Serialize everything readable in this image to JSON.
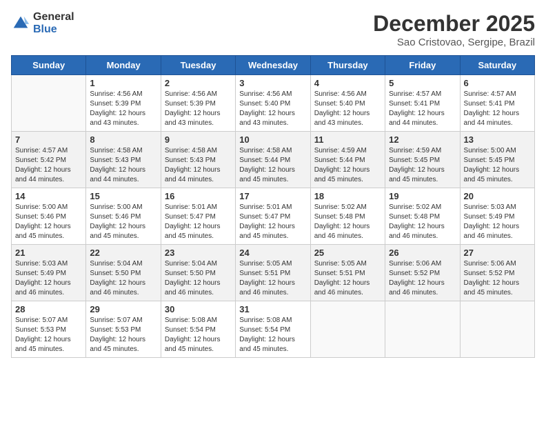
{
  "header": {
    "logo_general": "General",
    "logo_blue": "Blue",
    "month_title": "December 2025",
    "location": "Sao Cristovao, Sergipe, Brazil"
  },
  "days_of_week": [
    "Sunday",
    "Monday",
    "Tuesday",
    "Wednesday",
    "Thursday",
    "Friday",
    "Saturday"
  ],
  "weeks": [
    [
      {
        "day": "",
        "info": ""
      },
      {
        "day": "1",
        "info": "Sunrise: 4:56 AM\nSunset: 5:39 PM\nDaylight: 12 hours\nand 43 minutes."
      },
      {
        "day": "2",
        "info": "Sunrise: 4:56 AM\nSunset: 5:39 PM\nDaylight: 12 hours\nand 43 minutes."
      },
      {
        "day": "3",
        "info": "Sunrise: 4:56 AM\nSunset: 5:40 PM\nDaylight: 12 hours\nand 43 minutes."
      },
      {
        "day": "4",
        "info": "Sunrise: 4:56 AM\nSunset: 5:40 PM\nDaylight: 12 hours\nand 43 minutes."
      },
      {
        "day": "5",
        "info": "Sunrise: 4:57 AM\nSunset: 5:41 PM\nDaylight: 12 hours\nand 44 minutes."
      },
      {
        "day": "6",
        "info": "Sunrise: 4:57 AM\nSunset: 5:41 PM\nDaylight: 12 hours\nand 44 minutes."
      }
    ],
    [
      {
        "day": "7",
        "info": "Sunrise: 4:57 AM\nSunset: 5:42 PM\nDaylight: 12 hours\nand 44 minutes."
      },
      {
        "day": "8",
        "info": "Sunrise: 4:58 AM\nSunset: 5:43 PM\nDaylight: 12 hours\nand 44 minutes."
      },
      {
        "day": "9",
        "info": "Sunrise: 4:58 AM\nSunset: 5:43 PM\nDaylight: 12 hours\nand 44 minutes."
      },
      {
        "day": "10",
        "info": "Sunrise: 4:58 AM\nSunset: 5:44 PM\nDaylight: 12 hours\nand 45 minutes."
      },
      {
        "day": "11",
        "info": "Sunrise: 4:59 AM\nSunset: 5:44 PM\nDaylight: 12 hours\nand 45 minutes."
      },
      {
        "day": "12",
        "info": "Sunrise: 4:59 AM\nSunset: 5:45 PM\nDaylight: 12 hours\nand 45 minutes."
      },
      {
        "day": "13",
        "info": "Sunrise: 5:00 AM\nSunset: 5:45 PM\nDaylight: 12 hours\nand 45 minutes."
      }
    ],
    [
      {
        "day": "14",
        "info": "Sunrise: 5:00 AM\nSunset: 5:46 PM\nDaylight: 12 hours\nand 45 minutes."
      },
      {
        "day": "15",
        "info": "Sunrise: 5:00 AM\nSunset: 5:46 PM\nDaylight: 12 hours\nand 45 minutes."
      },
      {
        "day": "16",
        "info": "Sunrise: 5:01 AM\nSunset: 5:47 PM\nDaylight: 12 hours\nand 45 minutes."
      },
      {
        "day": "17",
        "info": "Sunrise: 5:01 AM\nSunset: 5:47 PM\nDaylight: 12 hours\nand 45 minutes."
      },
      {
        "day": "18",
        "info": "Sunrise: 5:02 AM\nSunset: 5:48 PM\nDaylight: 12 hours\nand 46 minutes."
      },
      {
        "day": "19",
        "info": "Sunrise: 5:02 AM\nSunset: 5:48 PM\nDaylight: 12 hours\nand 46 minutes."
      },
      {
        "day": "20",
        "info": "Sunrise: 5:03 AM\nSunset: 5:49 PM\nDaylight: 12 hours\nand 46 minutes."
      }
    ],
    [
      {
        "day": "21",
        "info": "Sunrise: 5:03 AM\nSunset: 5:49 PM\nDaylight: 12 hours\nand 46 minutes."
      },
      {
        "day": "22",
        "info": "Sunrise: 5:04 AM\nSunset: 5:50 PM\nDaylight: 12 hours\nand 46 minutes."
      },
      {
        "day": "23",
        "info": "Sunrise: 5:04 AM\nSunset: 5:50 PM\nDaylight: 12 hours\nand 46 minutes."
      },
      {
        "day": "24",
        "info": "Sunrise: 5:05 AM\nSunset: 5:51 PM\nDaylight: 12 hours\nand 46 minutes."
      },
      {
        "day": "25",
        "info": "Sunrise: 5:05 AM\nSunset: 5:51 PM\nDaylight: 12 hours\nand 46 minutes."
      },
      {
        "day": "26",
        "info": "Sunrise: 5:06 AM\nSunset: 5:52 PM\nDaylight: 12 hours\nand 46 minutes."
      },
      {
        "day": "27",
        "info": "Sunrise: 5:06 AM\nSunset: 5:52 PM\nDaylight: 12 hours\nand 45 minutes."
      }
    ],
    [
      {
        "day": "28",
        "info": "Sunrise: 5:07 AM\nSunset: 5:53 PM\nDaylight: 12 hours\nand 45 minutes."
      },
      {
        "day": "29",
        "info": "Sunrise: 5:07 AM\nSunset: 5:53 PM\nDaylight: 12 hours\nand 45 minutes."
      },
      {
        "day": "30",
        "info": "Sunrise: 5:08 AM\nSunset: 5:54 PM\nDaylight: 12 hours\nand 45 minutes."
      },
      {
        "day": "31",
        "info": "Sunrise: 5:08 AM\nSunset: 5:54 PM\nDaylight: 12 hours\nand 45 minutes."
      },
      {
        "day": "",
        "info": ""
      },
      {
        "day": "",
        "info": ""
      },
      {
        "day": "",
        "info": ""
      }
    ]
  ]
}
